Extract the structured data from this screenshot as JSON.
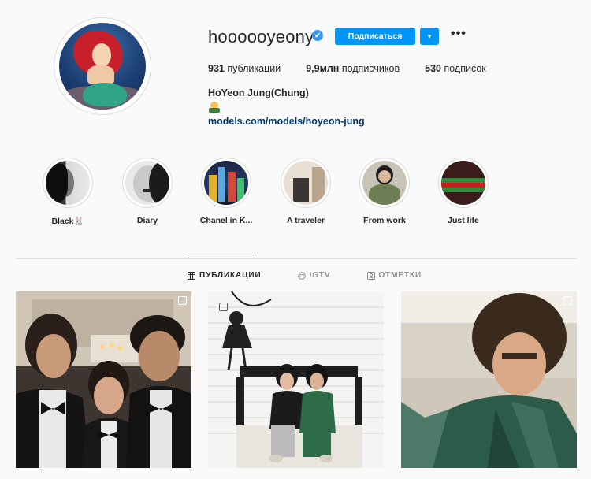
{
  "profile": {
    "username": "hoooooyeony",
    "verified_glyph": "✔",
    "follow_label": "Подписаться",
    "dropdown_glyph": "▾",
    "more_glyph": "•••",
    "full_name": "HoYeon Jung(Chung)",
    "website": "models.com/models/hoyeon-jung"
  },
  "stats": [
    {
      "value": "931",
      "label": "публикаций"
    },
    {
      "value": "9,9млн",
      "label": "подписчиков"
    },
    {
      "value": "530",
      "label": "подписок"
    }
  ],
  "highlights": [
    {
      "label": "Black🐰"
    },
    {
      "label": "Diary"
    },
    {
      "label": "Chanel in K..."
    },
    {
      "label": "A traveler"
    },
    {
      "label": "From work"
    },
    {
      "label": "Just life"
    }
  ],
  "tabs": [
    {
      "label": "ПУБЛИКАЦИИ",
      "icon": "grid-icon",
      "active": true
    },
    {
      "label": "IGTV",
      "icon": "igtv-icon",
      "active": false
    },
    {
      "label": "ОТМЕТКИ",
      "icon": "tagged-icon",
      "active": false
    }
  ],
  "colors": {
    "accent": "#0095f6",
    "link": "#00376b",
    "text": "#262626",
    "muted": "#8e8e8e"
  }
}
